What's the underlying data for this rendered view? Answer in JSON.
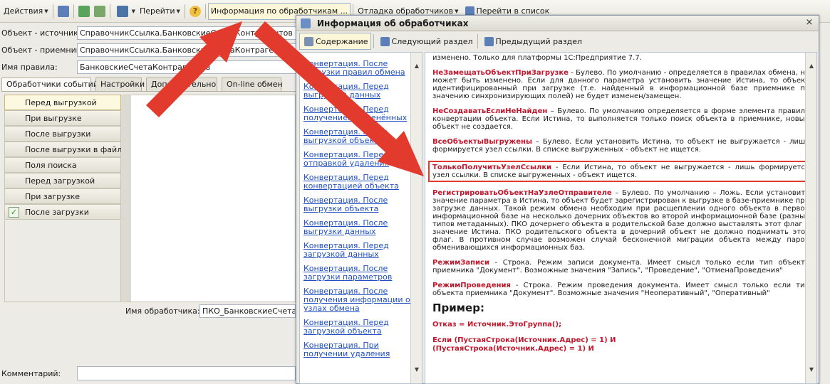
{
  "toolbar": {
    "actions": "Действия",
    "goto": "Перейти",
    "info": "Информация по обработчикам ...",
    "debug": "Отладка обработчиков",
    "goto_list": "Перейти в список"
  },
  "form": {
    "source_label": "Объект - источник:",
    "source_value": "СправочникСсылка.БанковскиеСчетаКонтрагентов",
    "target_label": "Объект - приемник:",
    "target_value": "СправочникСсылка.БанковскиеСчетаКонтрагентов",
    "rule_label": "Имя правила:",
    "rule_value": "БанковскиеСчетаКонтрагентов",
    "handler_label": "Имя обработчика:",
    "handler_value": "ПКО_БанковскиеСчетаКонтрагентов_ПослеЗагрузки",
    "comment_label": "Комментарий:"
  },
  "tabs": [
    "Обработчики событий",
    "Настройки",
    "Дополнительно",
    "On-line обмен"
  ],
  "events": [
    "Перед выгрузкой",
    "При выгрузке",
    "После выгрузки",
    "После выгрузки в файл",
    "Поля поиска",
    "Перед загрузкой",
    "При загрузке",
    "После загрузки"
  ],
  "info_window": {
    "title": "Информация об обработчиках",
    "close": "×",
    "btn_contents": "Содержание",
    "btn_next": "Следующий раздел",
    "btn_prev": "Предыдущий раздел"
  },
  "toc": [
    "Конвертация. После загрузки правил обмена",
    "Конвертация. Перед выгрузкой данных",
    "Конвертация. Перед получением изменённых",
    "Конвертация. После выгрузкой объекта",
    "Конвертация. Перед отправкой удаления",
    "Конвертация. Перед конвертацией объекта",
    "Конвертация. После выгрузки объекта",
    "Конвертация. После выгрузки данных",
    "Конвертация. Перед загрузкой данных",
    "Конвертация. После загрузки параметров",
    "Конвертация. После получения информации об узлах обмена",
    "Конвертация. Перед загрузкой объекта",
    "Конвертация. При получении удаления"
  ],
  "doc": {
    "p0": "изменено. Только для платформы 1С:Предприятие 7.7.",
    "k1": "НеЗамещатьОбъектПриЗагрузке",
    "p1": " - Булево. По умолчанию - определяется в правилах обмена, но может быть изменено. Если для данного параметра установить значение Истина, то объект идентифицированный при загрузке (т.е. найденный в информационной базе приемнике по значению синхронизирующих полей) не будет изменен/замещен.",
    "k2": "НеСоздаватьЕслиНеНайден",
    "p2": " – Булево. По умолчанию определяется в форме элемента правила конвертации объекта. Если Истина, то выполняется только поиск объекта в приемнике, новый объект не создается.",
    "k3": "ВсеОбъектыВыгружены",
    "p3": " – Булево. Если установить Истина, то объект не выгружается - лишь формируется узел ссылки. В списке выгруженных - объект не ищется.",
    "k4": "ТолькоПолучитьУзелСсылки",
    "p4": " - Если Истина, то объект не выгружается - лишь формируется узел ссылки. В списке выгруженных - объект ищется.",
    "k5": "РегистрироватьОбъектНаУзлеОтправителе",
    "p5": " – Булево. По умолчанию – Ложь. Если установить значение параметра в Истина, то объект будет зарегистрирован к выгрузке в базе-приемнике при загрузке данных. Такой режим обмена необходим при расщеплении одного объекта в первой информационной базе на несколько дочерних объектов во второй информационной базе (разных типов метаданных). ПКО дочернего объекта в родительской базе должно выставлять этот флаг в значение Истина. ПКО родительского объекта в дочерний объект не должно поднимать этот флаг. В противном случае возможен случай бесконечной миграции объекта между парой обменивающихся информационных баз.",
    "k6": "РежимЗаписи",
    "p6": " - Строка. Режим записи документа. Имеет смысл только если тип объекта приемника \"Документ\". Возможные значения \"Запись\", \"Проведение\", \"ОтменаПроведения\"",
    "k7": "РежимПроведения",
    "p7": " - Строка. Режим проведения документа. Имеет смысл только если тип объекта приемника \"Документ\". Возможные значения \"Неоперативный\", \"Оперативный\"",
    "example": "Пример:",
    "code1": "Отказ = Источник.ЭтоГруппа();",
    "code2": "Если (ПустаяСтрока(Источник.Адрес) = 1) И",
    "code3": "(ПустаяСтрока(Источник.Адрес) = 1) И"
  },
  "colors": {
    "accent_red": "#e23a2d",
    "link": "#1f4fc2",
    "keyword": "#c0172c"
  }
}
